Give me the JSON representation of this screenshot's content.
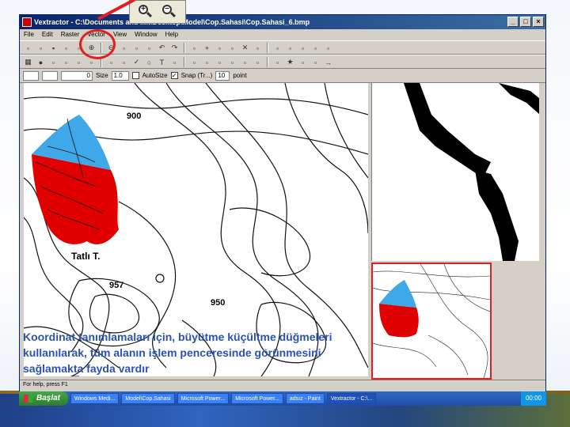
{
  "window": {
    "title": "Vextractor - C:\\Documents and ...it\\Desktop\\Model\\Cop.Sahasi\\Cop.Sahasi_6.bmp",
    "controls": [
      "_",
      "□",
      "×"
    ]
  },
  "menu": [
    "File",
    "Edit",
    "Raster",
    "Vector",
    "View",
    "Window",
    "Help"
  ],
  "toolbar1_icons": [
    "new-icon",
    "open-icon",
    "save-icon",
    "print-icon",
    "cut-icon",
    "zoom-in-icon",
    "zoom-out-icon",
    "fit-icon",
    "pan-icon",
    "select-icon",
    "undo-icon",
    "redo-icon",
    "grid-icon",
    "cross-icon",
    "line-icon",
    "curve-icon",
    "delete-icon",
    "raster-icon",
    "vector-icon",
    "vector-edit-icon",
    "layer-icon",
    "color-icon",
    "info-icon"
  ],
  "toolbar2_icons": [
    "palette-icon",
    "globe-icon",
    "fill-icon",
    "filter-icon",
    "bitmap-icon",
    "edit-pen-icon",
    "node-icon",
    "smooth-icon",
    "check-icon",
    "circle-icon",
    "text-icon",
    "brush-icon",
    "erase-icon",
    "measure-icon",
    "eye-icon",
    "transform-icon",
    "magic-icon",
    "marker-icon",
    "pencil-icon",
    "star-icon",
    "table-icon",
    "dash-icon",
    "arrow-icon"
  ],
  "options": {
    "label1": "Size",
    "value1": "1.0",
    "autosize": "AutoSize",
    "snap_label": "Snap (Tr...)",
    "value2": "10",
    "unit": "point",
    "zero": "0"
  },
  "zoom_callout": {
    "plus": "+",
    "minus": "−"
  },
  "map_labels": {
    "contour_900": "900",
    "place": "Tatlı T.",
    "peak": "957",
    "contour_950": "950"
  },
  "caption": "Koordinat tanımlamaları için, büyütme küçültme düğmeleri kullanılarak, tüm alanın işlem penceresinde görünmesini sağlamakta fayda vardır",
  "status": "For help, press F1",
  "taskbar": {
    "start": "Başlat",
    "items": [
      "Windows Medi...",
      "Model\\Cop.Sahasi",
      "Microsoft Power...",
      "Microsoft Power...",
      "adsız - Paint",
      "Vextractor - C:\\..."
    ],
    "tray": "00:00"
  },
  "colors": {
    "red_region": "#e00000",
    "blue_region": "#3fa8e8",
    "caption_text": "#2b52b0",
    "highlight": "#e02020"
  }
}
